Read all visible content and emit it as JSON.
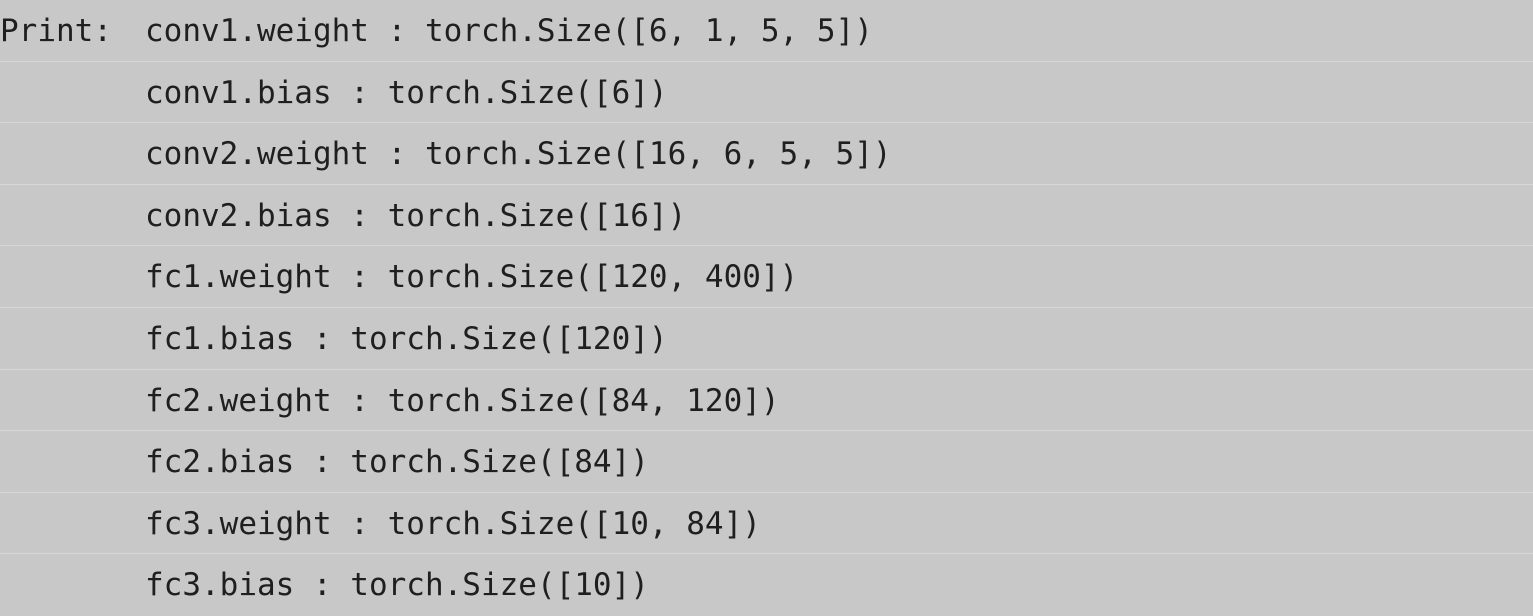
{
  "output": {
    "prefix": "Print:",
    "lines": [
      "conv1.weight : torch.Size([6, 1, 5, 5])",
      "conv1.bias : torch.Size([6])",
      "conv2.weight : torch.Size([16, 6, 5, 5])",
      "conv2.bias : torch.Size([16])",
      "fc1.weight : torch.Size([120, 400])",
      "fc1.bias : torch.Size([120])",
      "fc2.weight : torch.Size([84, 120])",
      "fc2.bias : torch.Size([84])",
      "fc3.weight : torch.Size([10, 84])",
      "fc3.bias : torch.Size([10])"
    ]
  },
  "colors": {
    "background": "#c8c8c8",
    "text": "#1f1f1f",
    "row_separator": "#d7d7d7"
  }
}
